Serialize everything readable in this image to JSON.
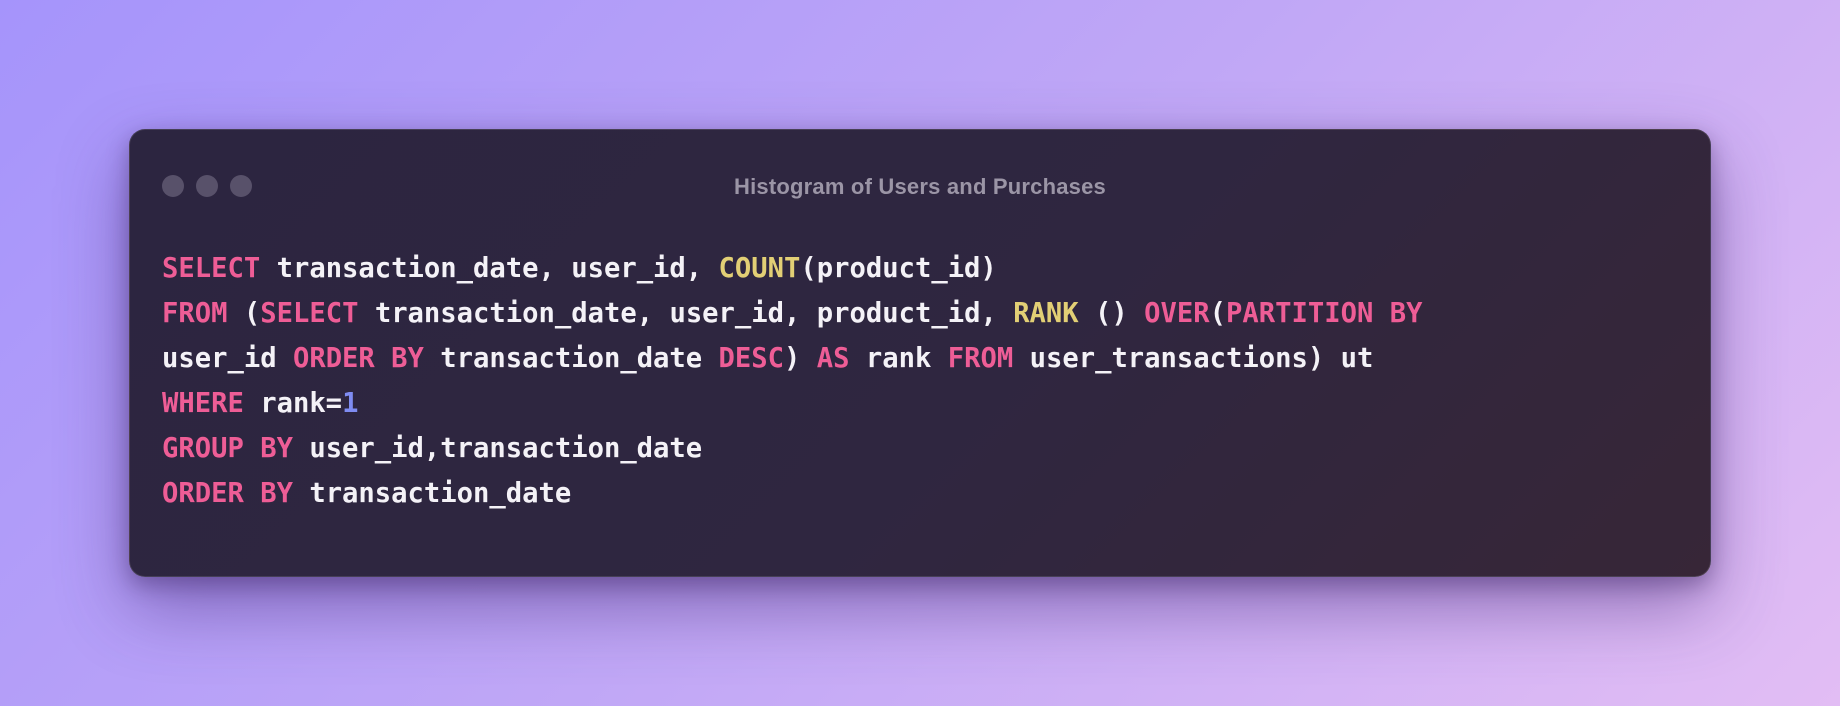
{
  "window": {
    "title": "Histogram of Users and Purchases"
  },
  "colors": {
    "keyword": "#ee5d96",
    "function": "#e2cf75",
    "number": "#7f8cf2",
    "text": "#f4f2f7"
  },
  "code": {
    "lines": [
      [
        {
          "text": "SELECT",
          "type": "keyword"
        },
        {
          "text": " transaction_date, user_id, ",
          "type": "text"
        },
        {
          "text": "COUNT",
          "type": "function"
        },
        {
          "text": "(product_id)",
          "type": "text"
        }
      ],
      [
        {
          "text": "FROM",
          "type": "keyword"
        },
        {
          "text": " (",
          "type": "text"
        },
        {
          "text": "SELECT",
          "type": "keyword"
        },
        {
          "text": " transaction_date, user_id, product_id, ",
          "type": "text"
        },
        {
          "text": "RANK",
          "type": "function"
        },
        {
          "text": " () ",
          "type": "text"
        },
        {
          "text": "OVER",
          "type": "keyword"
        },
        {
          "text": "(",
          "type": "text"
        },
        {
          "text": "PARTITION BY",
          "type": "keyword"
        }
      ],
      [
        {
          "text": "user_id ",
          "type": "text"
        },
        {
          "text": "ORDER BY",
          "type": "keyword"
        },
        {
          "text": " transaction_date ",
          "type": "text"
        },
        {
          "text": "DESC",
          "type": "keyword"
        },
        {
          "text": ") ",
          "type": "text"
        },
        {
          "text": "AS",
          "type": "keyword"
        },
        {
          "text": " rank ",
          "type": "text"
        },
        {
          "text": "FROM",
          "type": "keyword"
        },
        {
          "text": " user_transactions) ut",
          "type": "text"
        }
      ],
      [
        {
          "text": "WHERE",
          "type": "keyword"
        },
        {
          "text": " rank=",
          "type": "text"
        },
        {
          "text": "1",
          "type": "number"
        }
      ],
      [
        {
          "text": "GROUP BY",
          "type": "keyword"
        },
        {
          "text": " user_id,transaction_date",
          "type": "text"
        }
      ],
      [
        {
          "text": "ORDER BY",
          "type": "keyword"
        },
        {
          "text": " transaction_date",
          "type": "text"
        }
      ]
    ]
  }
}
